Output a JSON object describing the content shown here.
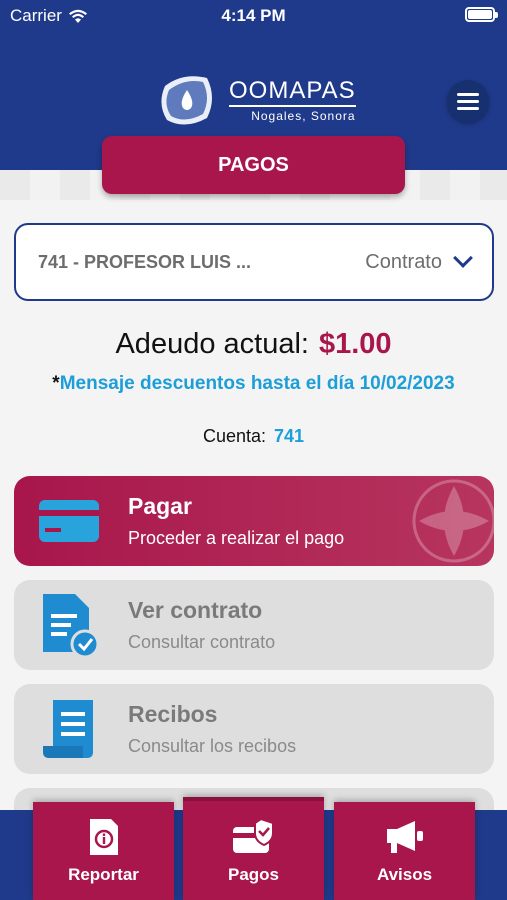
{
  "status_bar": {
    "carrier": "Carrier",
    "time": "4:14 PM"
  },
  "header": {
    "brand_name": "OOMAPAS",
    "brand_location": "Nogales, Sonora",
    "menu_icon": "hamburger-menu-icon"
  },
  "page_tab": {
    "label": "PAGOS"
  },
  "contract_select": {
    "selected_value": "741 - PROFESOR LUIS ...",
    "label": "Contrato",
    "icon": "chevron-down-icon"
  },
  "debt": {
    "label": "Adeudo actual:",
    "amount": "$1.00"
  },
  "discount_message": {
    "prefix": "*",
    "text": "Mensaje descuentos hasta el día 10/02/2023"
  },
  "account": {
    "label": "Cuenta:",
    "value": "741"
  },
  "actions": [
    {
      "title": "Pagar",
      "subtitle": "Proceder a realizar el pago",
      "icon": "credit-card-icon"
    },
    {
      "title": "Ver contrato",
      "subtitle": "Consultar contrato",
      "icon": "document-check-icon"
    },
    {
      "title": "Recibos",
      "subtitle": "Consultar los recibos",
      "icon": "receipt-icon"
    }
  ],
  "bottom_nav": [
    {
      "label": "Reportar",
      "icon": "report-document-icon"
    },
    {
      "label": "Pagos",
      "icon": "payment-card-icon"
    },
    {
      "label": "Avisos",
      "icon": "megaphone-icon"
    }
  ],
  "colors": {
    "primary_blue": "#1f3a8a",
    "accent_magenta": "#a8164b",
    "link_blue": "#1c9ed8",
    "card_gray": "#dedede"
  }
}
